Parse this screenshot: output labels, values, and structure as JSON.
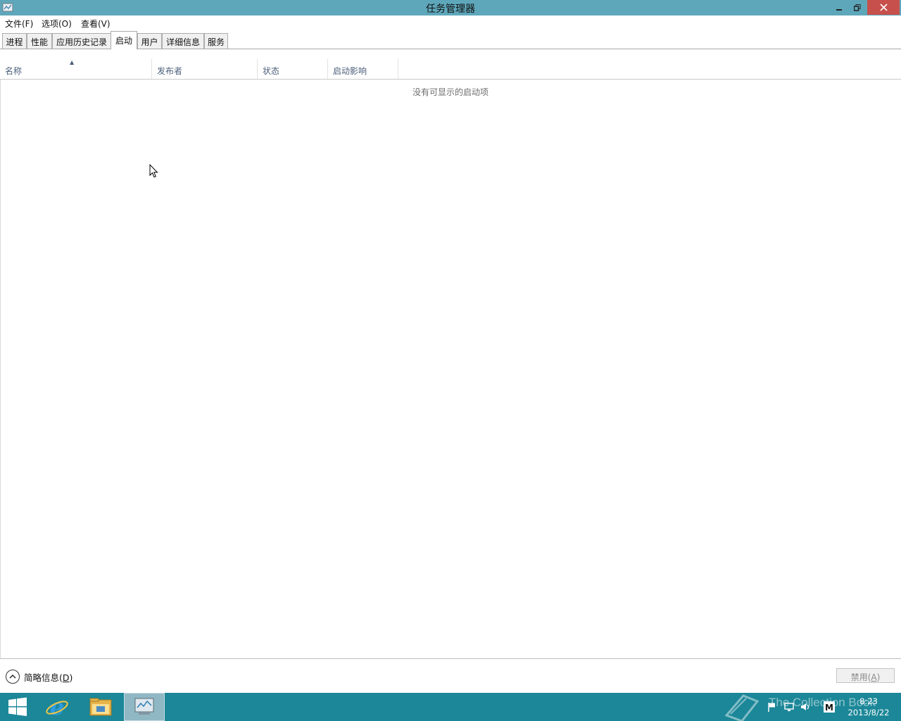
{
  "window": {
    "title": "任务管理器"
  },
  "menu": {
    "file": "文件(F)",
    "options": "选项(O)",
    "view": "查看(V)"
  },
  "tabs": [
    {
      "label": "进程",
      "active": false
    },
    {
      "label": "性能",
      "active": false
    },
    {
      "label": "应用历史记录",
      "active": false
    },
    {
      "label": "启动",
      "active": true
    },
    {
      "label": "用户",
      "active": false
    },
    {
      "label": "详细信息",
      "active": false
    },
    {
      "label": "服务",
      "active": false
    }
  ],
  "table": {
    "columns": [
      "名称",
      "发布者",
      "状态",
      "启动影响"
    ],
    "sort_indicator": "ascending",
    "empty_message": "没有可显示的启动项"
  },
  "footer": {
    "fewer_details_label": "简略信息",
    "fewer_details_key": "D",
    "disable_button_label": "禁用",
    "disable_button_key": "A"
  },
  "taskbar": {
    "pinned": [
      "windows-logo-icon",
      "internet-explorer-icon",
      "file-explorer-icon",
      "task-manager-icon"
    ],
    "active_app": "task-manager-icon",
    "tray": [
      "action-center-flag-icon",
      "network-icon",
      "volume-icon",
      "input-method-icon"
    ],
    "clock_time": "8:23",
    "clock_date": "2013/8/22",
    "watermark": "The Collection Book"
  },
  "colors": {
    "titlebar": "#5ea7bb",
    "close_button": "#c7504c",
    "taskbar": "#1b8798",
    "column_header_text": "#4c607a"
  }
}
